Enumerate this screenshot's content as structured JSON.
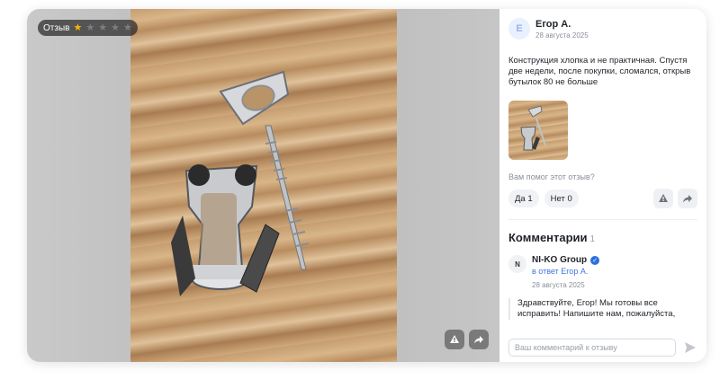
{
  "media": {
    "badge_label": "Отзыв",
    "rating": 1,
    "max_rating": 5,
    "actions": [
      {
        "icon": "report-icon"
      },
      {
        "icon": "share-icon"
      }
    ]
  },
  "review": {
    "avatar_letter": "Е",
    "author": "Егор А.",
    "date": "28 августа 2025",
    "text": "Конструкция хлопка и не практичная. Спустя две недели, после покупки, сломался, открыв бутылок 80 не больше",
    "helpful_question": "Вам помог этот отзыв?",
    "yes_label": "Да 1",
    "no_label": "Нет 0"
  },
  "comments": {
    "title": "Комментарии",
    "count": "1",
    "items": [
      {
        "avatar_letter": "N",
        "author": "NI-KO Group",
        "verified_icon": "check-icon",
        "reply_to": "в ответ Егор А.",
        "date": "28 августа 2025",
        "text": "Здравствуйте, Егор! Мы готовы все исправить! Напишите нам, пожалуйста,"
      }
    ],
    "input_placeholder": "Ваш комментарий к отзыву"
  },
  "colors": {
    "accent": "#3f76e0",
    "star": "#ffb400"
  }
}
